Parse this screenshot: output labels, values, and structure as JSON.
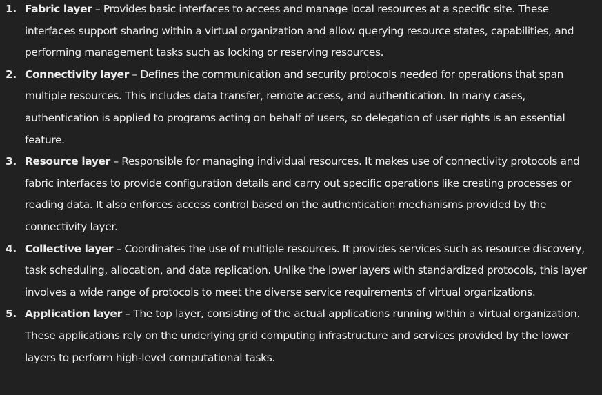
{
  "items": [
    {
      "number": "1.",
      "term": "Fabric layer",
      "desc": "Provides basic interfaces to access and manage local resources at a specific site. These interfaces support sharing within a virtual organization and allow querying resource states, capabilities, and performing management tasks such as locking or reserving resources."
    },
    {
      "number": "2.",
      "term": "Connectivity layer",
      "desc": "Defines the communication and security protocols needed for operations that span multiple resources. This includes data transfer, remote access, and authentication. In many cases, authentication is applied to programs acting on behalf of users, so delegation of user rights is an essential feature."
    },
    {
      "number": "3.",
      "term": "Resource layer",
      "desc": "Responsible for managing individual resources. It makes use of connectivity protocols and fabric interfaces to provide configuration details and carry out specific operations like creating processes or reading data. It also enforces access control based on the authentication mechanisms provided by the connectivity layer."
    },
    {
      "number": "4.",
      "term": "Collective layer",
      "desc": "Coordinates the use of multiple resources. It provides services such as resource discovery, task scheduling, allocation, and data replication. Unlike the lower layers with standardized protocols, this layer involves a wide range of protocols to meet the diverse service requirements of virtual organizations."
    },
    {
      "number": "5.",
      "term": "Application layer",
      "desc": "The top layer, consisting of the actual applications running within a virtual organization. These applications rely on the underlying grid computing infrastructure and services provided by the lower layers to perform high-level computational tasks."
    }
  ],
  "separator": " – "
}
